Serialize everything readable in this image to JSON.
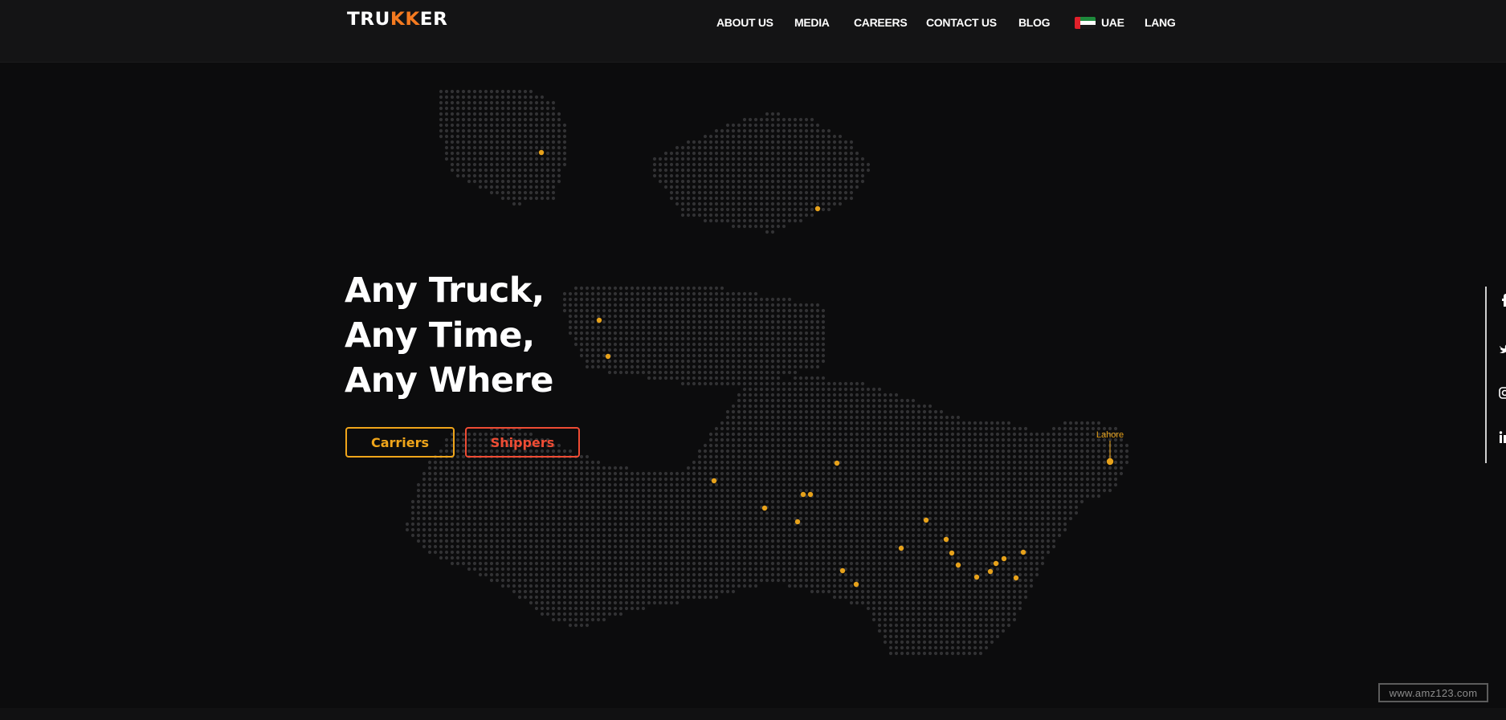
{
  "header": {
    "logo": {
      "text_a": "TRU",
      "text_b": "KK",
      "text_c": "ER"
    },
    "nav": [
      {
        "label": "ABOUT US"
      },
      {
        "label": "MEDIA"
      },
      {
        "label": "CAREERS"
      },
      {
        "label": "CONTACT US"
      },
      {
        "label": "BLOG"
      },
      {
        "label": "UAE"
      },
      {
        "label": "LANG"
      }
    ]
  },
  "hero": {
    "lines": [
      "Any Truck,",
      "Any Time,",
      "Any Where"
    ],
    "buttons": {
      "carriers": "Carriers",
      "shippers": "Shippers"
    }
  },
  "map": {
    "city_label": "Lahore"
  },
  "social": {
    "icons": [
      "facebook-icon",
      "twitter-icon",
      "instagram-icon",
      "linkedin-icon"
    ]
  },
  "watermark": "www.amz123.com",
  "colors": {
    "background": "#0c0c0d",
    "dot": "#3a3a3c",
    "accent_orange": "#f0a51a",
    "accent_red": "#ef4c34",
    "logo_accent": "#f47a20"
  }
}
